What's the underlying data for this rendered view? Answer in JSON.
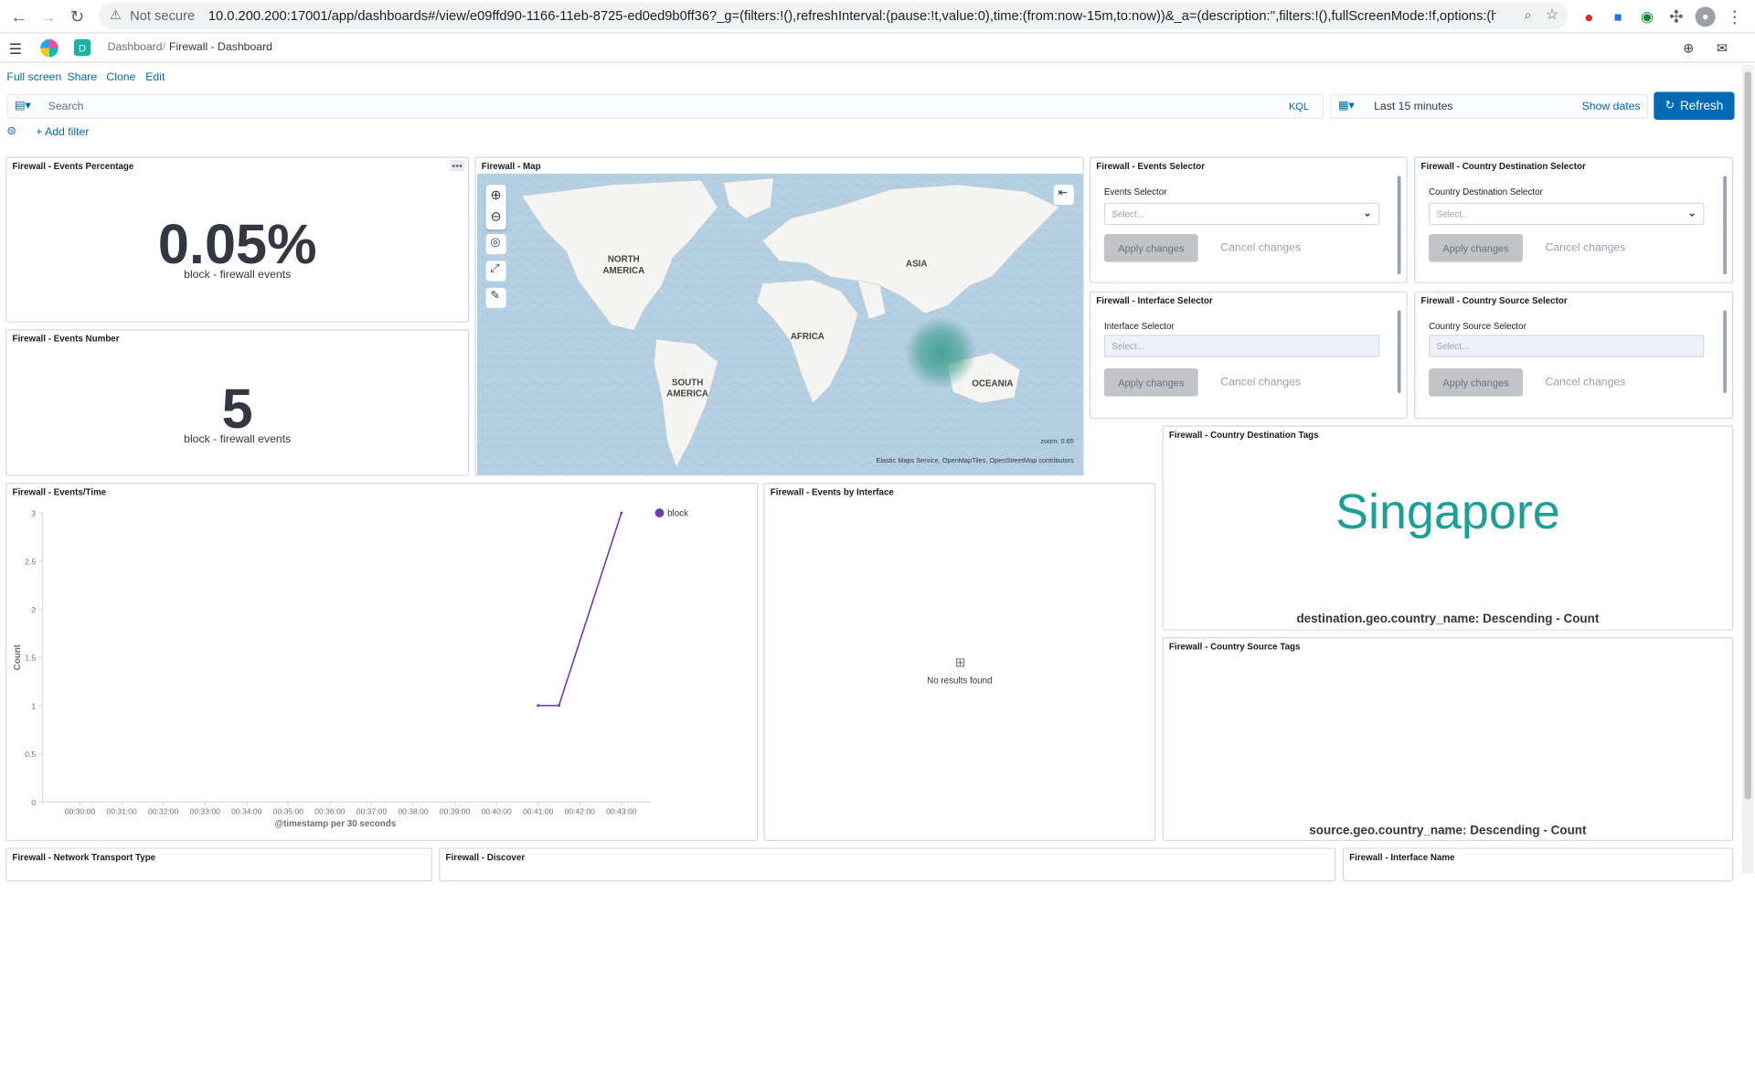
{
  "browser": {
    "not_secure": "Not secure",
    "url": "10.0.200.200:17001/app/dashboards#/view/e09ffd90-1166-11eb-8725-ed0ed9b0ff36?_g=(filters:!(),refreshInterval:(pause:!t,value:0),time:(from:now-15m,to:now))&_a=(description:'',filters:!(),fullScreenMode:!f,options:(hidePanelTitl..."
  },
  "header": {
    "space_badge": "D",
    "breadcrumb_root": "Dashboard",
    "breadcrumb_current": "Firewall - Dashboard",
    "separator": "/"
  },
  "top_nav": [
    "Full screen",
    "Share",
    "Clone",
    "Edit"
  ],
  "query": {
    "placeholder": "Search",
    "language": "KQL",
    "time_range": "Last 15 minutes",
    "show_dates": "Show dates",
    "refresh": "Refresh",
    "add_filter": "+ Add filter"
  },
  "panels": {
    "events_percentage": {
      "title": "Firewall - Events Percentage",
      "value": "0.05%",
      "label": "block - firewall events"
    },
    "events_number": {
      "title": "Firewall - Events Number",
      "value": "5",
      "label": "block - firewall events"
    },
    "map": {
      "title": "Firewall - Map",
      "continents": [
        "NORTH AMERICA",
        "ASIA",
        "AFRICA",
        "SOUTH AMERICA",
        "OCEANIA"
      ],
      "attribution": "Elastic Maps Service, OpenMapTiles, OpenStreetMap contributors",
      "zoom": "zoom: 0.65"
    },
    "events_selector": {
      "title": "Firewall - Events Selector",
      "label": "Events Selector",
      "placeholder": "Select...",
      "apply": "Apply changes",
      "cancel": "Cancel changes"
    },
    "country_dest_selector": {
      "title": "Firewall - Country Destination Selector",
      "label": "Country Destination Selector",
      "placeholder": "Select...",
      "apply": "Apply changes",
      "cancel": "Cancel changes"
    },
    "interface_selector": {
      "title": "Firewall - Interface Selector",
      "label": "Interface Selector",
      "placeholder": "Select...",
      "apply": "Apply changes",
      "cancel": "Cancel changes"
    },
    "country_source_selector": {
      "title": "Firewall - Country Source Selector",
      "label": "Country Source Selector",
      "placeholder": "Select...",
      "apply": "Apply changes",
      "cancel": "Cancel changes"
    },
    "country_dest_tags": {
      "title": "Firewall - Country Destination Tags",
      "tag": "Singapore",
      "footer": "destination.geo.country_name: Descending - Count"
    },
    "country_source_tags": {
      "title": "Firewall - Country Source Tags",
      "footer": "source.geo.country_name: Descending - Count"
    },
    "events_time": {
      "title": "Firewall - Events/Time"
    },
    "events_by_interface": {
      "title": "Firewall - Events by Interface",
      "empty": "No results found"
    },
    "network_transport": {
      "title": "Firewall - Network Transport Type"
    },
    "discover": {
      "title": "Firewall - Discover"
    },
    "interface_name": {
      "title": "Firewall - Interface Name"
    }
  },
  "chart_data": {
    "type": "line",
    "title": "",
    "xlabel": "@timestamp per 30 seconds",
    "ylabel": "Count",
    "categories": [
      "00:30:00",
      "00:31:00",
      "00:32:00",
      "00:33:00",
      "00:34:00",
      "00:35:00",
      "00:36:00",
      "00:37:00",
      "00:38:00",
      "00:39:00",
      "00:40:00",
      "00:41:00",
      "00:42:00",
      "00:43:00"
    ],
    "yticks": [
      "0",
      "0.5",
      "1",
      "1.5",
      "2",
      "2.5",
      "3"
    ],
    "ylim": [
      0,
      3
    ],
    "series": [
      {
        "name": "block",
        "color": "#6a3bb5",
        "points": [
          [
            "00:41:00",
            1
          ],
          [
            "00:41:30",
            1
          ],
          [
            "00:43:00",
            3
          ]
        ]
      }
    ],
    "legend": "top-right",
    "grid": false
  }
}
